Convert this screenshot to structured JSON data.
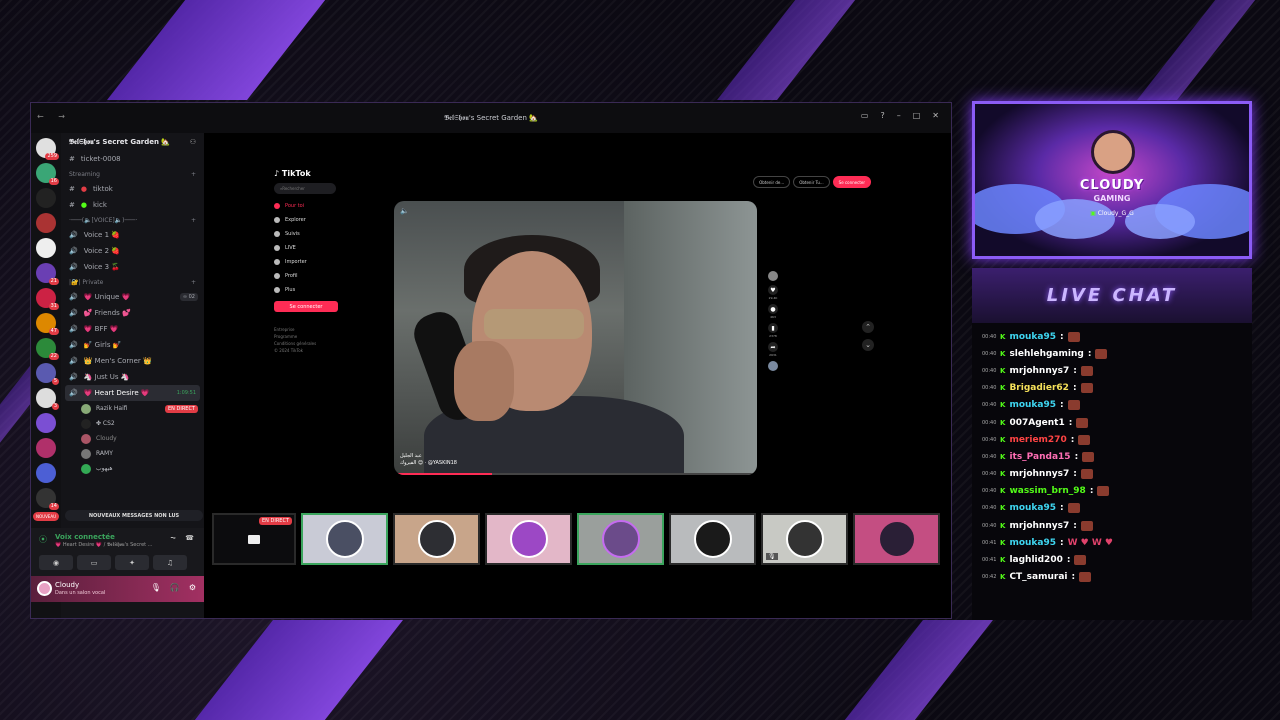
{
  "window": {
    "title": "𝕭𝖊𝖑𝕾𝖍𝖔𝖚's Secret Garden 🏡",
    "controls": [
      "▭",
      "?",
      "–",
      "□",
      "✕"
    ]
  },
  "discord": {
    "server_name": "𝕭𝖊𝖑𝕾𝖍𝖔𝖚's Secret Garden 🏡",
    "top_channel": "ticket-0008",
    "categories": {
      "streaming": "Streaming",
      "voice": "·───(🔈[VOICE]🔈)───·",
      "private": "|🔐| Private"
    },
    "streaming_channels": [
      "tiktok",
      "kick"
    ],
    "voice_channels": [
      "Voice 1 🍓",
      "Voice 2 🍓",
      "Voice 3 🍒"
    ],
    "private_channels": [
      "💗 Unique 💗",
      "💕 Friends 💕",
      "💗 BFF 💗",
      "💅 Girls 💅",
      "👑 Men's Corner 👑",
      "🦄 Just Us 🦄"
    ],
    "unique_badge": "∞ 02",
    "active_channel": "💗 Heart Desire 💗",
    "active_timer": "1:09:51",
    "members": [
      "Razik Haifi",
      "✤ CS2",
      "Cloudy",
      "RAMY",
      "هيهوب"
    ],
    "live_label": "EN DIRECT",
    "new_messages": "NOUVEAUX MESSAGES NON LUS",
    "new_badge": "NOUVEAU",
    "voice_connected": "Voix connectée",
    "voice_location": "💗 Heart Desire 💗 / 𝕭𝖊𝖑𝕾𝖍𝖔𝖚's Secret ...",
    "user_name": "Cloudy",
    "user_status": "Dans un salon vocal",
    "server_badges": [
      "259",
      "16",
      "",
      "",
      "",
      "21",
      "31",
      "47",
      "22",
      "5",
      "3",
      "",
      "",
      "",
      "14"
    ]
  },
  "tiktok": {
    "logo": "TikTok",
    "search_placeholder": "Rechercher",
    "nav": [
      "Pour toi",
      "Explorer",
      "Suivis",
      "LIVE",
      "Importer",
      "Profil",
      "Plus"
    ],
    "login": "Se connecter",
    "footer": [
      "Entreprise",
      "Programme",
      "Conditions générales",
      "© 2024 TikTok"
    ],
    "top_pills": [
      "Obtenir de...",
      "Obtenir Tu...",
      "Se connecter"
    ],
    "caption_line1": "عبد الجليل",
    "caption_line2": "الفيروك 😊 · @YASKIN18",
    "counts": [
      "29.4K",
      "463",
      "2378",
      "2631"
    ]
  },
  "webcam": {
    "logo_line1": "CLOUDY",
    "logo_line2": "GAMING",
    "username": "Cloudy_G_G"
  },
  "chat": {
    "title": "LIVE CHAT",
    "messages": [
      {
        "time": "00:40",
        "user": "mouka95",
        "color": "#3fd7f2",
        "text": "",
        "emote": true
      },
      {
        "time": "00:40",
        "user": "slehlehgaming",
        "color": "#ffffff",
        "text": "",
        "emote": true
      },
      {
        "time": "00:40",
        "user": "mrjohnnys7",
        "color": "#ffffff",
        "text": "",
        "emote": true
      },
      {
        "time": "00:40",
        "user": "Brigadier62",
        "color": "#f5e05a",
        "text": "",
        "emote": true
      },
      {
        "time": "00:40",
        "user": "mouka95",
        "color": "#3fd7f2",
        "text": "",
        "emote": true
      },
      {
        "time": "00:40",
        "user": "007Agent1",
        "color": "#ffffff",
        "text": "",
        "emote": true
      },
      {
        "time": "00:40",
        "user": "meriem270",
        "color": "#ff4444",
        "text": "",
        "emote": true
      },
      {
        "time": "00:40",
        "user": "its_Panda15",
        "color": "#ff6fb5",
        "text": "",
        "emote": true
      },
      {
        "time": "00:40",
        "user": "mrjohnnys7",
        "color": "#ffffff",
        "text": "",
        "emote": true
      },
      {
        "time": "00:40",
        "user": "wassim_brn_98",
        "color": "#53fc18",
        "text": "",
        "emote": true
      },
      {
        "time": "00:40",
        "user": "mouka95",
        "color": "#3fd7f2",
        "text": "",
        "emote": true
      },
      {
        "time": "00:40",
        "user": "mrjohnnys7",
        "color": "#ffffff",
        "text": "",
        "emote": true
      },
      {
        "time": "00:41",
        "user": "mouka95",
        "color": "#3fd7f2",
        "text": "W ♥ W ♥",
        "emote": false
      },
      {
        "time": "00:41",
        "user": "laghlid200",
        "color": "#ffffff",
        "text": "",
        "emote": true
      },
      {
        "time": "00:42",
        "user": "CT_samurai",
        "color": "#ffffff",
        "text": "",
        "emote": true
      }
    ]
  },
  "colors": {
    "accent": "#8b5cf6",
    "discord_green": "#3ba55d",
    "tiktok_red": "#fe2c55",
    "kick_green": "#53fc18",
    "live_red": "#e23c45"
  }
}
